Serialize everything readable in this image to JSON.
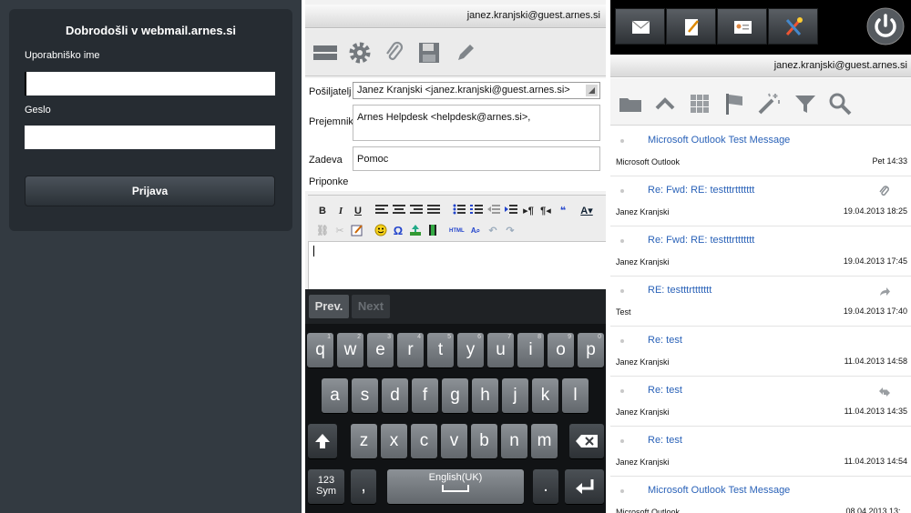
{
  "login": {
    "title": "Dobrodošli v webmail.arnes.si",
    "username_label": "Uporabniško ime",
    "username_value": "",
    "password_label": "Geslo",
    "password_value": "",
    "submit_label": "Prijava"
  },
  "compose": {
    "account": "janez.kranjski@guest.arnes.si",
    "toolbar_icons": [
      "menu-icon",
      "gear-icon",
      "paperclip-icon",
      "save-icon",
      "pencil-icon"
    ],
    "sender_label": "Pošiljatelj",
    "sender_value": "Janez Kranjski <janez.kranjski@guest.arnes.si>",
    "recipient_label": "Prejemnik",
    "recipient_value": "Arnes Helpdesk <helpdesk@arnes.si>,",
    "subject_label": "Zadeva",
    "subject_value": "Pomoc",
    "attachments_label": "Priponke",
    "editor": {
      "bold": "B",
      "italic": "I",
      "underline": "U",
      "body": ""
    },
    "keyboard": {
      "prev_label": "Prev.",
      "next_label": "Next",
      "row1": [
        "q",
        "w",
        "e",
        "r",
        "t",
        "y",
        "u",
        "i",
        "o",
        "p"
      ],
      "row1_hints": [
        "1",
        "2",
        "3",
        "4",
        "5",
        "6",
        "7",
        "8",
        "9",
        "0"
      ],
      "row2": [
        "a",
        "s",
        "d",
        "f",
        "g",
        "h",
        "j",
        "k",
        "l"
      ],
      "row3": [
        "z",
        "x",
        "c",
        "v",
        "b",
        "n",
        "m"
      ],
      "sym_label_1": "123",
      "sym_label_2": "Sym",
      "comma_key": ",",
      "space_label": "English(UK)",
      "period_key": "."
    }
  },
  "inbox": {
    "account": "janez.kranjski@guest.arnes.si",
    "nav_icons": [
      "mail-icon",
      "compose-note-icon",
      "contact-card-icon",
      "tools-icon"
    ],
    "toolbar_icons": [
      "folder-icon",
      "chevron-up-icon",
      "grid-icon",
      "flag-icon",
      "magic-wand-icon",
      "filter-icon",
      "search-icon"
    ],
    "messages": [
      {
        "subject": "Microsoft Outlook Test Message",
        "from": "Microsoft Outlook",
        "date": "Pet 14:33",
        "flag": ""
      },
      {
        "subject": "Re: Fwd: RE: testttrttttttt",
        "from": "Janez Kranjski",
        "date": "19.04.2013 18:25",
        "flag": "paperclip-icon"
      },
      {
        "subject": "Re: Fwd: RE: testttrttttttt",
        "from": "Janez Kranjski",
        "date": "19.04.2013 17:45",
        "flag": ""
      },
      {
        "subject": "RE: testttrttttttt",
        "from": "Test",
        "date": "19.04.2013 17:40",
        "flag": "forwarded-icon"
      },
      {
        "subject": "Re: test",
        "from": "Janez Kranjski",
        "date": "11.04.2013 14:58",
        "flag": ""
      },
      {
        "subject": "Re: test",
        "from": "Janez Kranjski",
        "date": "11.04.2013 14:35",
        "flag": "replied-forwarded-icon"
      },
      {
        "subject": "Re: test",
        "from": "Janez Kranjski",
        "date": "11.04.2013 14:54",
        "flag": ""
      },
      {
        "subject": "Microsoft Outlook Test Message",
        "from": "Microsoft Outlook",
        "date": "08.04.2013 13:...",
        "flag": ""
      }
    ]
  }
}
